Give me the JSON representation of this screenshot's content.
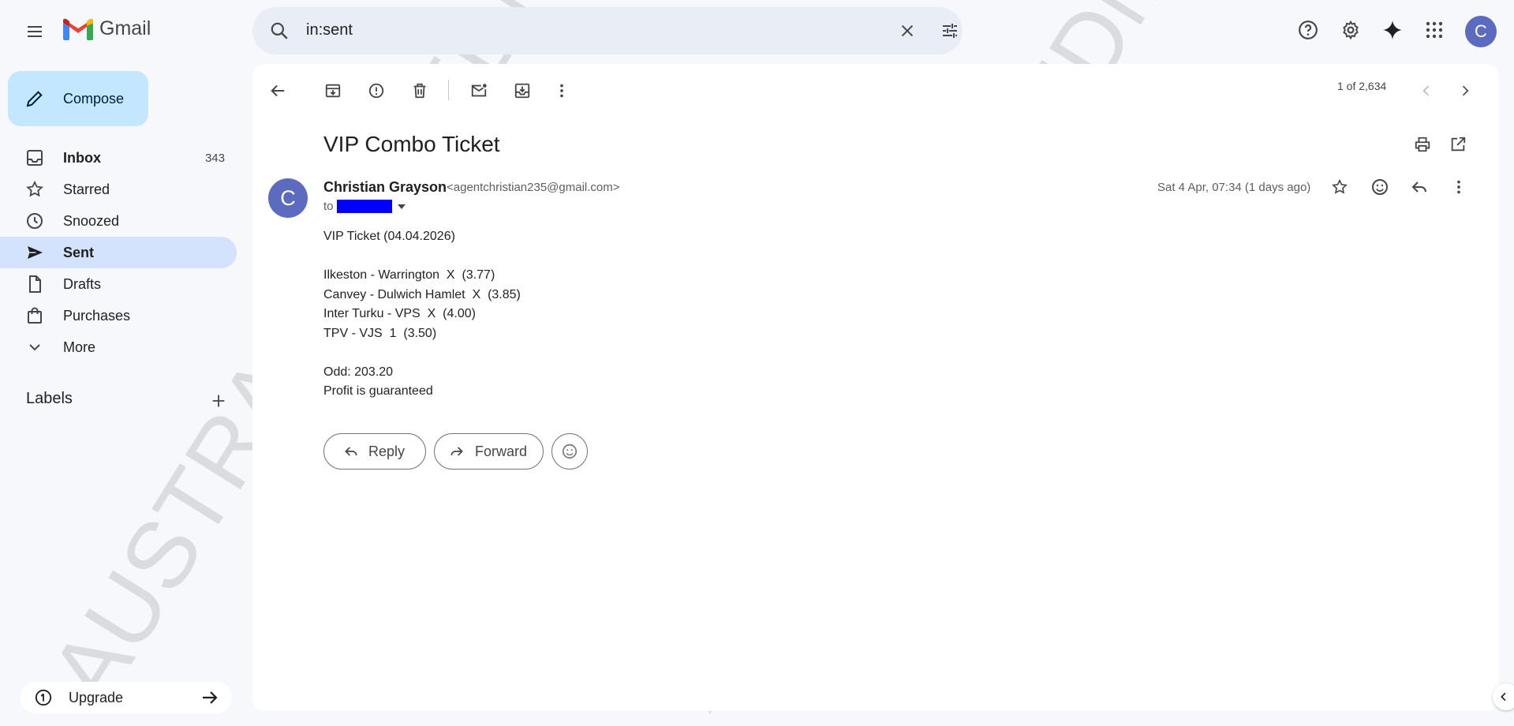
{
  "app": {
    "name": "Gmail"
  },
  "search": {
    "query": "in:sent"
  },
  "account": {
    "initial": "C"
  },
  "compose": {
    "label": "Compose"
  },
  "sidebar": {
    "items": [
      {
        "label": "Inbox",
        "count": "343",
        "icon": "inbox-icon"
      },
      {
        "label": "Starred",
        "count": "",
        "icon": "star-icon"
      },
      {
        "label": "Snoozed",
        "count": "",
        "icon": "clock-icon"
      },
      {
        "label": "Sent",
        "count": "",
        "icon": "send-icon"
      },
      {
        "label": "Drafts",
        "count": "",
        "icon": "draft-icon"
      },
      {
        "label": "Purchases",
        "count": "",
        "icon": "shopping-bag-icon"
      },
      {
        "label": "More",
        "count": "",
        "icon": "chevron-down-icon"
      }
    ],
    "active_item": "Sent",
    "labels_heading": "Labels",
    "upgrade_label": "Upgrade"
  },
  "toolbar": {
    "pager": "1 of 2,634"
  },
  "message": {
    "subject": "VIP Combo Ticket",
    "sender_initial": "C",
    "sender_name": "Christian Grayson",
    "sender_email": "<agentchristian235@gmail.com>",
    "to_prefix": "to",
    "date": "Sat 4 Apr, 07:34 (1 days ago)",
    "body_lines": [
      "VIP Ticket (04.04.2026)",
      "",
      "Ilkeston - Warrington  X  (3.77)",
      "Canvey - Dulwich Hamlet  X  (3.85)",
      "Inter Turku - VPS  X  (4.00)",
      "TPV - VJS  1  (3.50)",
      "",
      "Odd: 203.20",
      "Profit is guaranteed"
    ]
  },
  "actions": {
    "reply": "Reply",
    "forward": "Forward"
  },
  "watermark": {
    "text": "AUSTRALIAFIXEDMATCHES"
  },
  "colors": {
    "background": "#f6f8fc",
    "compose_bg": "#c2e7ff",
    "active_nav": "#d3e3fd",
    "avatar": "#5c6bc0",
    "search_bg": "#e9eef6"
  }
}
